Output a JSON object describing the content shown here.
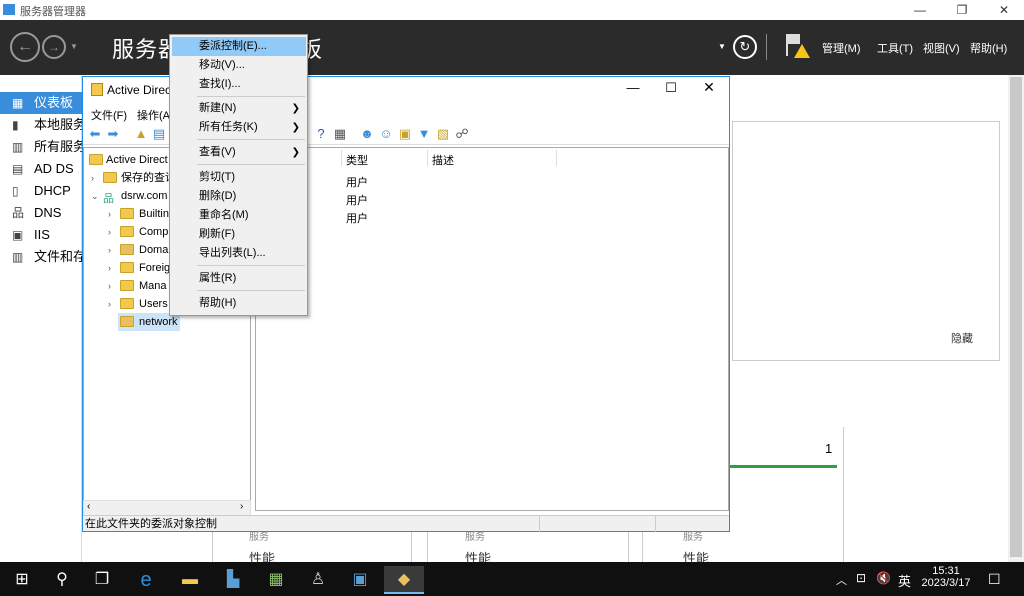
{
  "server_manager": {
    "window_title": "服务器管理器",
    "header_title_left": "服务器",
    "header_title_right": "板",
    "menus": [
      "管理(M)",
      "工具(T)",
      "视图(V)",
      "帮助(H)"
    ],
    "sidebar": [
      {
        "label": "仪表板",
        "icon": "dashboard-icon"
      },
      {
        "label": "本地服务",
        "icon": "local-server-icon"
      },
      {
        "label": "所有服务",
        "icon": "all-servers-icon"
      },
      {
        "label": "AD DS",
        "icon": "adds-icon"
      },
      {
        "label": "DHCP",
        "icon": "dhcp-icon"
      },
      {
        "label": "DNS",
        "icon": "dns-icon"
      },
      {
        "label": "IIS",
        "icon": "iis-icon"
      },
      {
        "label": "文件和存",
        "icon": "file-storage-icon"
      }
    ],
    "hide_label": "隐藏",
    "tile_count": "1",
    "tile_labels": [
      "服务",
      "服务",
      "服务"
    ],
    "tile_perf": [
      "性能",
      "性能",
      "性能"
    ]
  },
  "aduc": {
    "title": "Active Direct",
    "menubar": [
      "文件(F)",
      "操作(A"
    ],
    "tree": {
      "root": "Active Direct",
      "saved": "保存的查询",
      "domain": "dsrw.com",
      "children": [
        "Builtin",
        "Comp",
        "Doma",
        "Foreig",
        "Mana",
        "Users",
        "network"
      ]
    },
    "columns": [
      "类型",
      "描述"
    ],
    "rows": [
      {
        "type": "用户"
      },
      {
        "type": "用户"
      },
      {
        "type": "用户"
      }
    ],
    "status": "在此文件夹的委派对象控制"
  },
  "context_menu": {
    "items": [
      {
        "label": "委派控制(E)...",
        "highlighted": true
      },
      {
        "label": "移动(V)..."
      },
      {
        "label": "查找(I)..."
      },
      {
        "label": "新建(N)",
        "submenu": true
      },
      {
        "label": "所有任务(K)",
        "submenu": true
      },
      {
        "label": "查看(V)",
        "submenu": true
      },
      {
        "label": "剪切(T)"
      },
      {
        "label": "删除(D)"
      },
      {
        "label": "重命名(M)"
      },
      {
        "label": "刷新(F)"
      },
      {
        "label": "导出列表(L)..."
      },
      {
        "label": "属性(R)"
      },
      {
        "label": "帮助(H)"
      }
    ]
  },
  "taskbar": {
    "ime": "英",
    "time": "15:31",
    "date": "2023/3/17"
  },
  "colors": {
    "accent": "#3a8ddb",
    "menu_highlight": "#91c9f7",
    "header_bg": "#2b2b2b",
    "taskbar_bg": "#101010",
    "status_green": "#2ea043"
  }
}
